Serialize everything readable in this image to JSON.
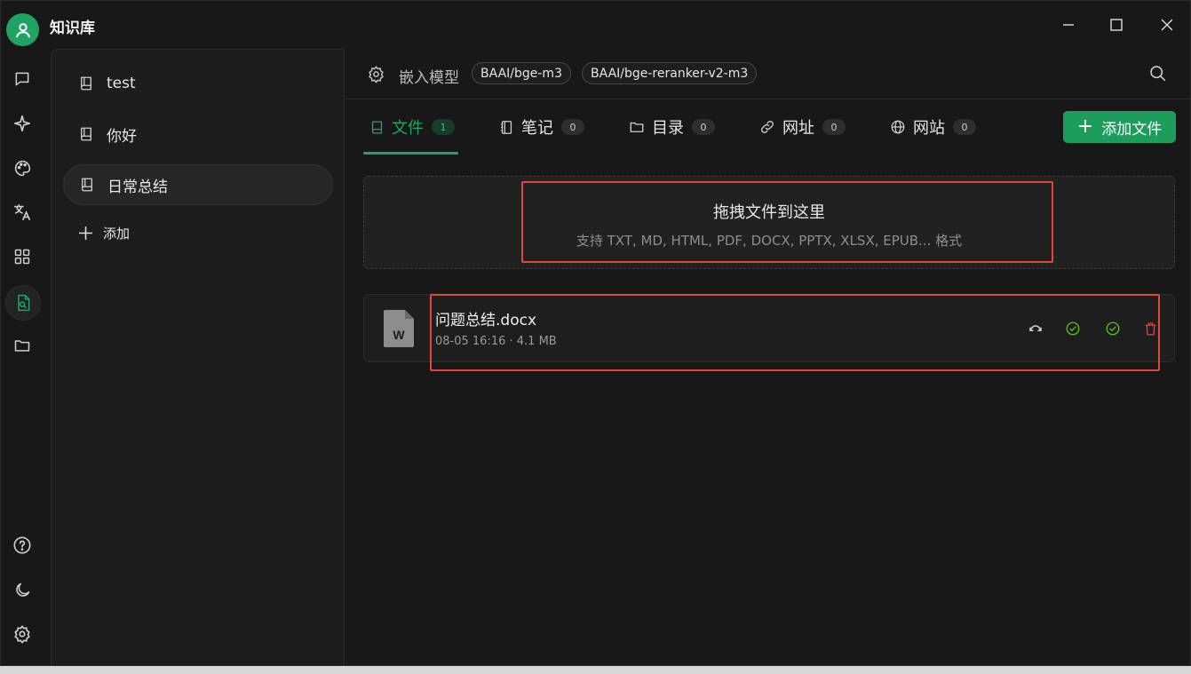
{
  "app": {
    "title": "知识库"
  },
  "window_controls": {
    "minimize": "minimize-icon",
    "maximize": "maximize-icon",
    "close": "close-icon"
  },
  "rail": {
    "top_icons": [
      "chat-icon",
      "sparkle-icon",
      "palette-icon",
      "translate-icon",
      "apps-grid-icon",
      "knowledge-icon",
      "folder-icon"
    ],
    "active": "knowledge-icon",
    "bottom_icons": [
      "help-icon",
      "moon-icon",
      "settings-icon"
    ]
  },
  "knowledge_bases": {
    "items": [
      {
        "label": "test"
      },
      {
        "label": "你好"
      },
      {
        "label": "日常总结",
        "active": true
      }
    ],
    "add_label": "添加"
  },
  "topbar": {
    "embed_label": "嵌入模型",
    "models": [
      "BAAI/bge-m3",
      "BAAI/bge-reranker-v2-m3"
    ]
  },
  "tabs": [
    {
      "label": "文件",
      "count": "1",
      "icon": "book-icon",
      "active": true
    },
    {
      "label": "笔记",
      "count": "0",
      "icon": "notebook-icon"
    },
    {
      "label": "目录",
      "count": "0",
      "icon": "folder-icon"
    },
    {
      "label": "网址",
      "count": "0",
      "icon": "link-icon"
    },
    {
      "label": "网站",
      "count": "0",
      "icon": "globe-icon"
    }
  ],
  "add_file_label": "添加文件",
  "dropzone": {
    "title": "拖拽文件到这里",
    "subtitle": "支持 TXT, MD, HTML, PDF, DOCX, PPTX, XLSX, EPUB... 格式"
  },
  "files": [
    {
      "name": "问题总结.docx",
      "meta": "08-05 16:16 · 4.1 MB",
      "icon_letter": "W"
    }
  ],
  "colors": {
    "accent": "#1fa463",
    "danger": "#e0473c",
    "highlight": "#e0473c"
  }
}
